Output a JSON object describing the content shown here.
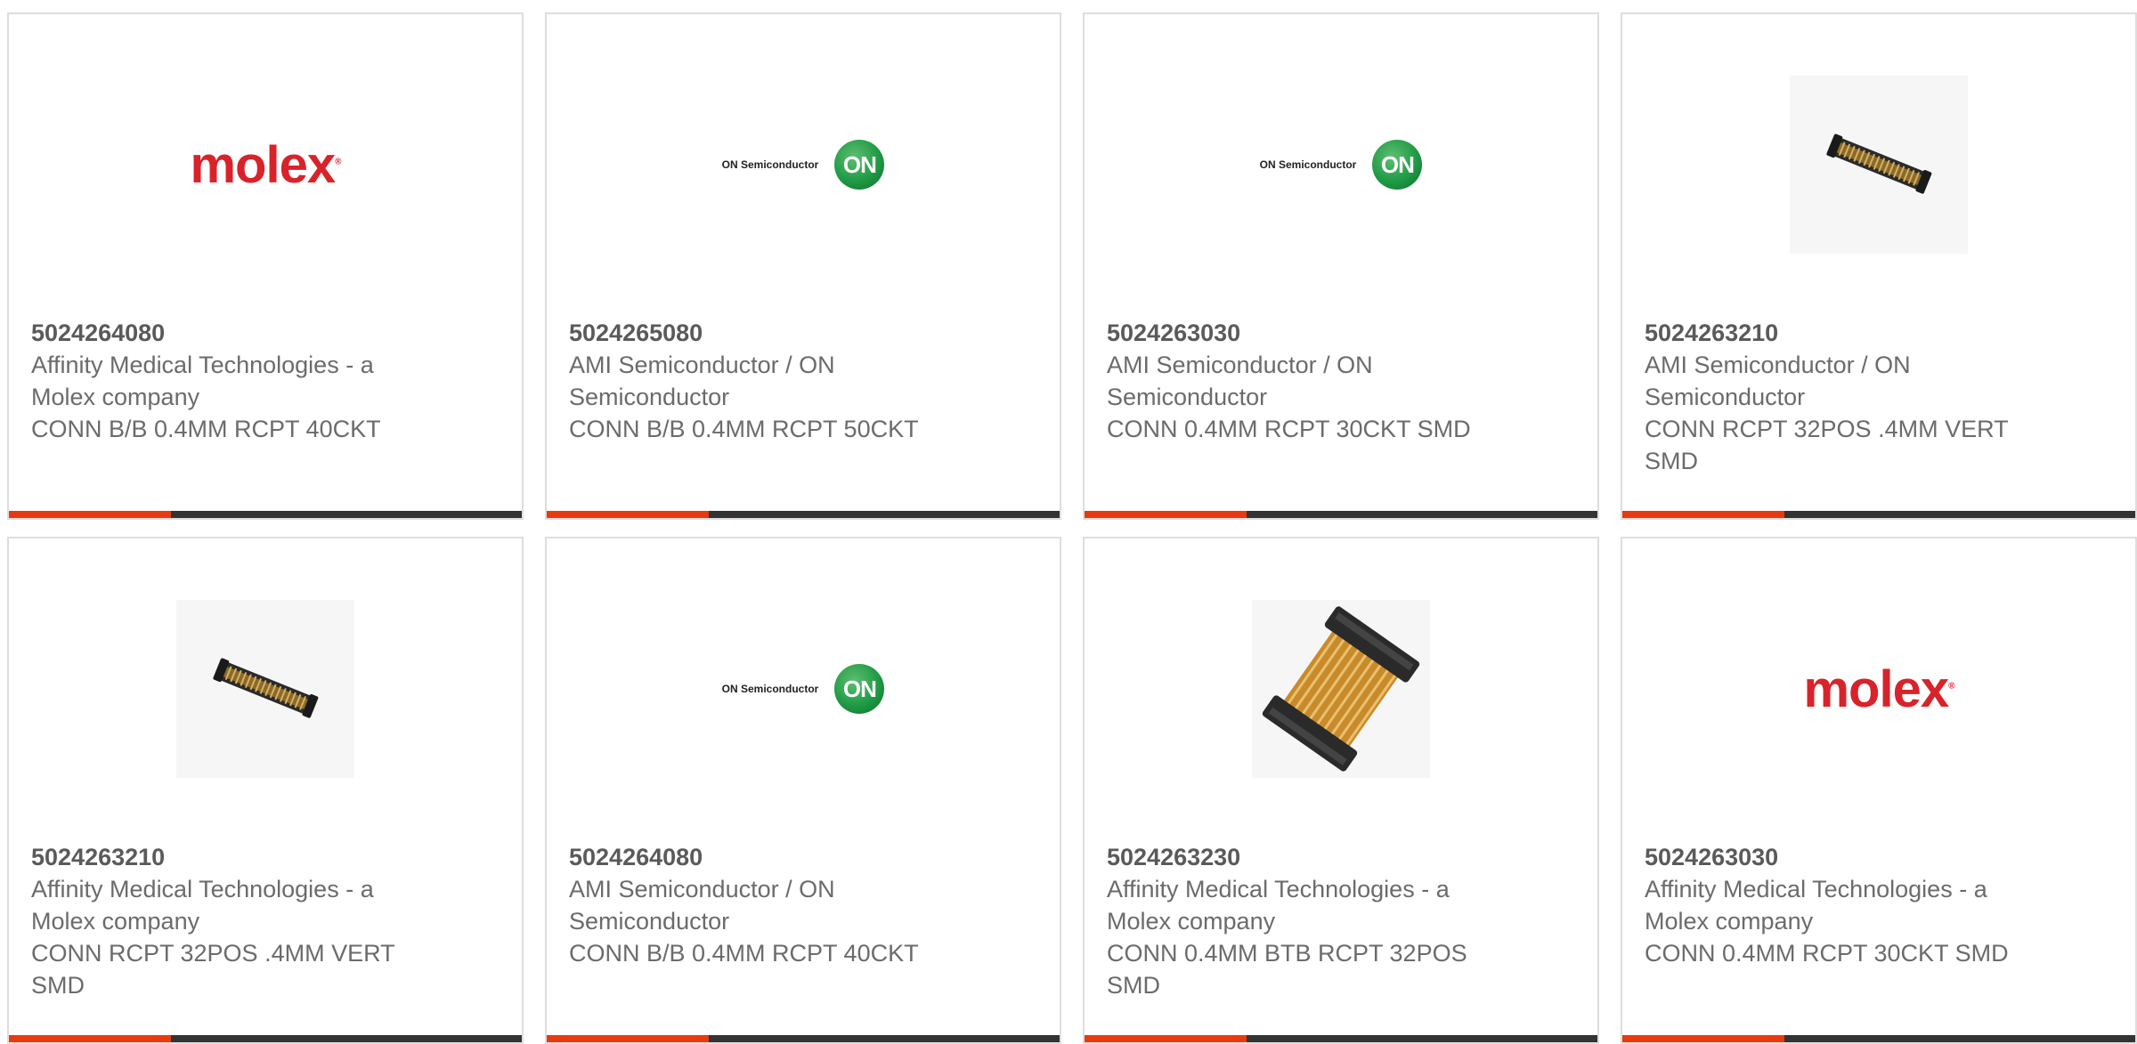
{
  "cards": [
    {
      "part_number": "5024264080",
      "manufacturer": "Affinity Medical Technologies - a Molex company",
      "description": "CONN B/B 0.4MM RCPT 40CKT",
      "image": "molex-logo",
      "logo_text": "molex"
    },
    {
      "part_number": "5024265080",
      "manufacturer": "AMI Semiconductor / ON Semiconductor",
      "description": "CONN B/B 0.4MM RCPT 50CKT",
      "image": "onsemi-logo",
      "logo_text": "ON Semiconductor",
      "badge_text": "ON"
    },
    {
      "part_number": "5024263030",
      "manufacturer": "AMI Semiconductor / ON Semiconductor",
      "description": "CONN 0.4MM RCPT 30CKT SMD",
      "image": "onsemi-logo",
      "logo_text": "ON Semiconductor",
      "badge_text": "ON"
    },
    {
      "part_number": "5024263210",
      "manufacturer": "AMI Semiconductor / ON Semiconductor",
      "description": "CONN RCPT 32POS .4MM VERT SMD",
      "image": "connector-photo-small"
    },
    {
      "part_number": "5024263210",
      "manufacturer": "Affinity Medical Technologies - a Molex company",
      "description": "CONN RCPT 32POS .4MM VERT SMD",
      "image": "connector-photo-small"
    },
    {
      "part_number": "5024264080",
      "manufacturer": "AMI Semiconductor / ON Semiconductor",
      "description": "CONN B/B 0.4MM RCPT 40CKT",
      "image": "onsemi-logo",
      "logo_text": "ON Semiconductor",
      "badge_text": "ON"
    },
    {
      "part_number": "5024263230",
      "manufacturer": "Affinity Medical Technologies - a Molex company",
      "description": "CONN 0.4MM BTB RCPT 32POS SMD",
      "image": "connector-photo-large"
    },
    {
      "part_number": "5024263030",
      "manufacturer": "Affinity Medical Technologies - a Molex company",
      "description": "CONN 0.4MM RCPT 30CKT SMD",
      "image": "molex-logo",
      "logo_text": "molex"
    }
  ],
  "colors": {
    "accent": "#e83a0e",
    "bar": "#333333",
    "text": "#6b6b6b",
    "molex_red": "#d8232a",
    "onsemi_green": "#1f9a45"
  }
}
